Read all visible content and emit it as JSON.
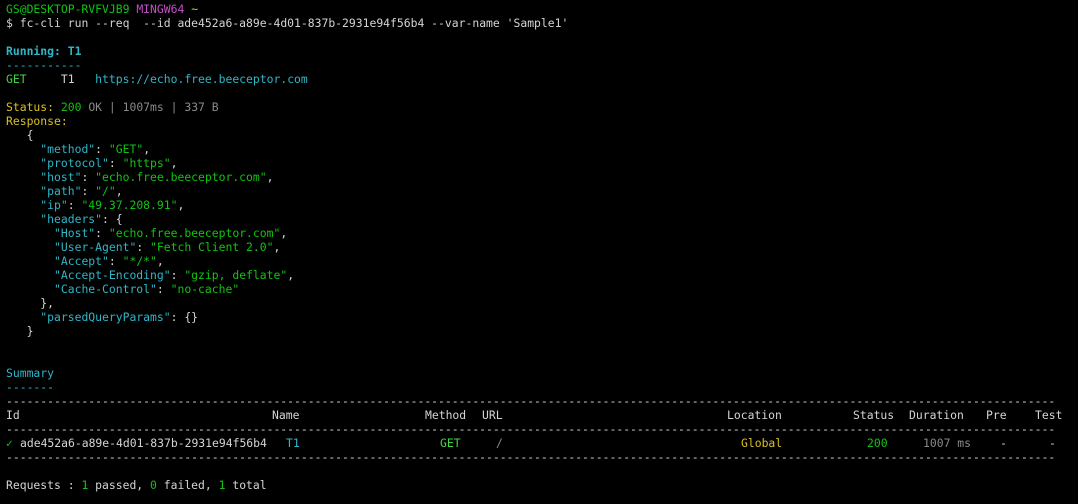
{
  "prompt": {
    "user_host": "GS@DESKTOP-RVFVJB9",
    "shell": "MINGW64",
    "path": "~",
    "symbol": "$",
    "command": "fc-cli run --req  --id ade452a6-a89e-4d01-837b-2931e94f56b4 --var-name 'Sample1'"
  },
  "run": {
    "running_label": "Running: T1",
    "dashes": "-----------",
    "method": "GET",
    "name": "T1",
    "url": "https://echo.free.beeceptor.com"
  },
  "status": {
    "label": "Status:",
    "code": "200",
    "text": "OK",
    "sep1": "|",
    "time": "1007ms",
    "sep2": "|",
    "size": "337 B"
  },
  "response": {
    "label": "Response:",
    "open_brace": "{",
    "close_brace": "}",
    "method_key": "\"method\"",
    "method_val": "\"GET\"",
    "protocol_key": "\"protocol\"",
    "protocol_val": "\"https\"",
    "host_key": "\"host\"",
    "host_val": "\"echo.free.beeceptor.com\"",
    "path_key": "\"path\"",
    "path_val": "\"/\"",
    "ip_key": "\"ip\"",
    "ip_val": "\"49.37.208.91\"",
    "headers_key": "\"headers\"",
    "headers_open": "{",
    "h_host_key": "\"Host\"",
    "h_host_val": "\"echo.free.beeceptor.com\"",
    "h_ua_key": "\"User-Agent\"",
    "h_ua_val": "\"Fetch Client 2.0\"",
    "h_accept_key": "\"Accept\"",
    "h_accept_val": "\"*/*\"",
    "h_enc_key": "\"Accept-Encoding\"",
    "h_enc_val": "\"gzip, deflate\"",
    "h_cache_key": "\"Cache-Control\"",
    "h_cache_val": "\"no-cache\"",
    "headers_close": "},",
    "pqp_key": "\"parsedQueryParams\"",
    "pqp_val": "{}"
  },
  "summary": {
    "title": "Summary",
    "underline": "-------",
    "rule": "--------------------------------------------------------------------------------------------------------------------------------------------------------------------------------------------------------",
    "headers": {
      "id": "Id",
      "name": "Name",
      "method": "Method",
      "url": "URL",
      "location": "Location",
      "status": "Status",
      "duration": "Duration",
      "pre": "Pre",
      "test": "Test"
    },
    "row": {
      "check": "✓",
      "id": "ade452a6-a89e-4d01-837b-2931e94f56b4",
      "name": "T1",
      "method": "GET",
      "url": "/",
      "location": "Global",
      "status": "200",
      "duration": "1007 ms",
      "pre": "-",
      "test": "-"
    }
  },
  "footer": {
    "label": "Requests :",
    "passed_count": "1",
    "passed_label": "passed,",
    "failed_count": "0",
    "failed_label": "failed,",
    "total_count": "1",
    "total_label": "total"
  }
}
